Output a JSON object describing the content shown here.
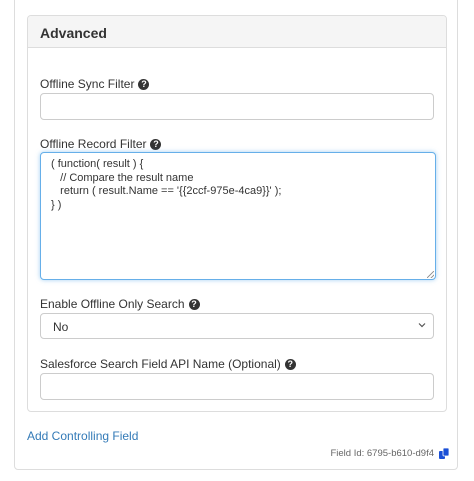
{
  "advanced": {
    "heading": "Advanced"
  },
  "fields": {
    "offline_sync_filter": {
      "label": "Offline Sync Filter",
      "value": "",
      "help_icon": "question-circle-icon"
    },
    "offline_record_filter": {
      "label": "Offline Record Filter",
      "help_icon": "question-circle-icon",
      "code": "( function( result ) {\n   // Compare the result name\n   return ( result.Name == '{{2ccf-975e-4ca9}}' );\n} )"
    },
    "enable_offline_only_search": {
      "label": "Enable Offline Only Search",
      "help_icon": "question-circle-icon",
      "selected": "No",
      "chevron_icon": "chevron-down-icon"
    },
    "salesforce_search_field": {
      "label": "Salesforce Search Field API Name (Optional)",
      "value": "",
      "help_icon": "question-circle-icon"
    }
  },
  "footer": {
    "add_controlling_field": "Add Controlling Field",
    "field_id": "Field Id: 6795-b610-d9f4",
    "copy_icon": "copy-clipboard-icon"
  },
  "colors": {
    "link": "#337ab7",
    "focus_border": "#66afe9",
    "copy_icon": "#1a4fd6"
  }
}
